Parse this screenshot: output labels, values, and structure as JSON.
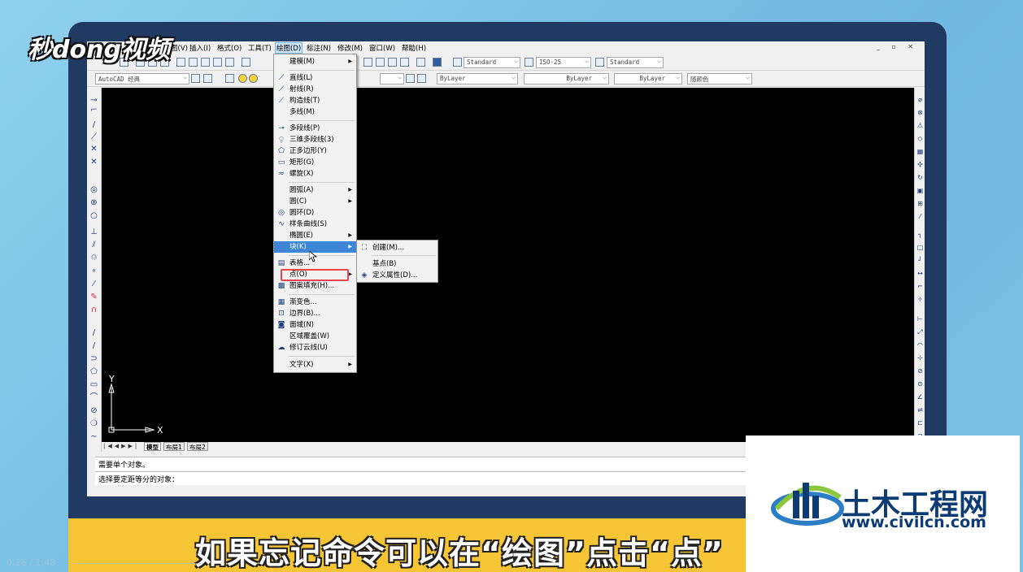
{
  "watermark_left": "秒dong视频",
  "watermark_right": {
    "title": "土木工程网",
    "url": "www.civilcn.com"
  },
  "subtitle": "如果忘记命令可以在“绘图”点击“点”",
  "video_time": "0:26 / 1:48",
  "menubar": {
    "items": [
      "图(V)",
      "插入(I)",
      "格式(O)",
      "工具(T)",
      "绘图(D)",
      "标注(N)",
      "修改(M)",
      "窗口(W)",
      "帮助(H)"
    ],
    "active": "绘图(D)"
  },
  "toolbar": {
    "text_style": "Standard",
    "dim_style": "ISO-25",
    "table_style": "Standard",
    "workspace": "AutoCAD 经典",
    "color": "ByLayer",
    "linetype": "ByLayer",
    "lineweight": "ByLayer",
    "plotstyle": "随颜色"
  },
  "draw_menu": {
    "items": [
      {
        "label": "建模(M)",
        "icon": "blank",
        "submenu": true
      },
      {
        "label": "直线(L)",
        "icon": "line-icon"
      },
      {
        "label": "射线(R)",
        "icon": "ray-icon"
      },
      {
        "label": "构造线(T)",
        "icon": "xline-icon"
      },
      {
        "label": "多线(M)",
        "icon": "blank"
      },
      {
        "label": "多段线(P)",
        "icon": "polyline-icon"
      },
      {
        "label": "三维多段线(3)",
        "icon": "3dpoly-icon"
      },
      {
        "label": "正多边形(Y)",
        "icon": "polygon-icon"
      },
      {
        "label": "矩形(G)",
        "icon": "rectangle-icon"
      },
      {
        "label": "螺旋(X)",
        "icon": "helix-icon"
      },
      {
        "label": "圆弧(A)",
        "icon": "blank",
        "submenu": true
      },
      {
        "label": "圆(C)",
        "icon": "blank",
        "submenu": true
      },
      {
        "label": "圆环(D)",
        "icon": "donut-icon"
      },
      {
        "label": "样条曲线(S)",
        "icon": "spline-icon"
      },
      {
        "label": "椭圆(E)",
        "icon": "blank",
        "submenu": true
      },
      {
        "label": "块(K)",
        "icon": "blank",
        "submenu": true
      },
      {
        "label": "表格...",
        "icon": "table-icon"
      },
      {
        "label": "点(O)",
        "icon": "blank",
        "submenu": true
      },
      {
        "label": "图案填充(H)...",
        "icon": "hatch-icon"
      },
      {
        "label": "渐变色...",
        "icon": "gradient-icon"
      },
      {
        "label": "边界(B)...",
        "icon": "boundary-icon"
      },
      {
        "label": "面域(N)",
        "icon": "region-icon"
      },
      {
        "label": "区域覆盖(W)",
        "icon": "blank"
      },
      {
        "label": "修订云线(U)",
        "icon": "revcloud-icon"
      },
      {
        "label": "文字(X)",
        "icon": "blank",
        "submenu": true
      }
    ],
    "highlighted": "块(K)",
    "boxed": "点(O)"
  },
  "block_submenu": {
    "items": [
      {
        "label": "创建(M)...",
        "icon": "block-create-icon"
      },
      {
        "label": "基点(B)",
        "icon": "blank"
      },
      {
        "label": "定义属性(D)...",
        "icon": "attdef-icon"
      }
    ]
  },
  "layout_tabs": [
    "模型",
    "布局1",
    "布局2"
  ],
  "active_tab": "模型",
  "command_lines": [
    "需要单个对象。",
    "选择要定距等分的对象："
  ],
  "ucs": {
    "y": "Y",
    "x": "X"
  }
}
